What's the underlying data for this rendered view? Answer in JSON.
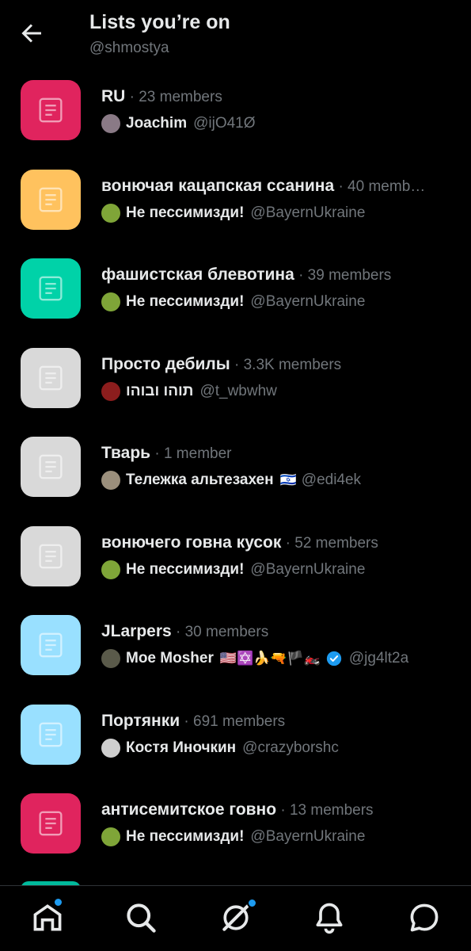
{
  "header": {
    "title": "Lists you’re on",
    "subtitle": "@shmostya"
  },
  "lists": [
    {
      "name": "RU",
      "members": " · 23 members",
      "color": "#e0245e",
      "owner": {
        "name": "Joachim",
        "handle": "@ijO41Ø",
        "avatar": "#8a7a86",
        "emoji": ""
      }
    },
    {
      "name": "вонючая кацапская ссанина",
      "members": " · 40 memb…",
      "color": "#ffc25e",
      "owner": {
        "name": "Не пессимизди!",
        "handle": "@BayernUkraine",
        "avatar": "#7fa538",
        "emoji": ""
      }
    },
    {
      "name": "фашистская блевотина",
      "members": " · 39 members",
      "color": "#00d2a8",
      "owner": {
        "name": "Не пессимизди!",
        "handle": "@BayernUkraine",
        "avatar": "#7fa538",
        "emoji": ""
      }
    },
    {
      "name": "Просто дебилы",
      "members": " · 3.3K members",
      "color": "#d9d9d9",
      "owner": {
        "name": "תוהו ובוהו",
        "handle": "@t_wbwhw",
        "avatar": "#8c1d1d",
        "emoji": ""
      }
    },
    {
      "name": "Тварь",
      "members": " · 1 member",
      "color": "#d9d9d9",
      "owner": {
        "name": "Тележка альтезахен",
        "handle": "@edi4ek",
        "avatar": "#9b8f7c",
        "emoji": "🇮🇱"
      }
    },
    {
      "name": "вонючего говна кусок",
      "members": " · 52 members",
      "color": "#d9d9d9",
      "owner": {
        "name": "Не пессимизди!",
        "handle": "@BayernUkraine",
        "avatar": "#7fa538",
        "emoji": ""
      }
    },
    {
      "name": "JLarpers",
      "members": " · 30 members",
      "color": "#99e0ff",
      "owner": {
        "name": "Moe Mosher",
        "handle": "@jg4lt2a",
        "avatar": "#5a5a4a",
        "emoji": "🇺🇸✡️🍌🔫🏴🏍️",
        "verified": true
      }
    },
    {
      "name": "Портянки",
      "members": " · 691 members",
      "color": "#99e0ff",
      "owner": {
        "name": "Костя Иночкин",
        "handle": "@crazyborshc",
        "avatar": "#cfcfcf",
        "emoji": ""
      }
    },
    {
      "name": "антисемитское говно",
      "members": " · 13 members",
      "color": "#e0245e",
      "owner": {
        "name": "Не пессимизди!",
        "handle": "@BayernUkraine",
        "avatar": "#7fa538",
        "emoji": ""
      }
    }
  ],
  "nav": [
    "home-icon",
    "search-icon",
    "grok-icon",
    "notifications-icon",
    "messages-icon"
  ],
  "colors": {
    "accent": "#1d9bf0",
    "muted": "#71767b",
    "text": "#e7e9ea",
    "background": "#000000"
  }
}
